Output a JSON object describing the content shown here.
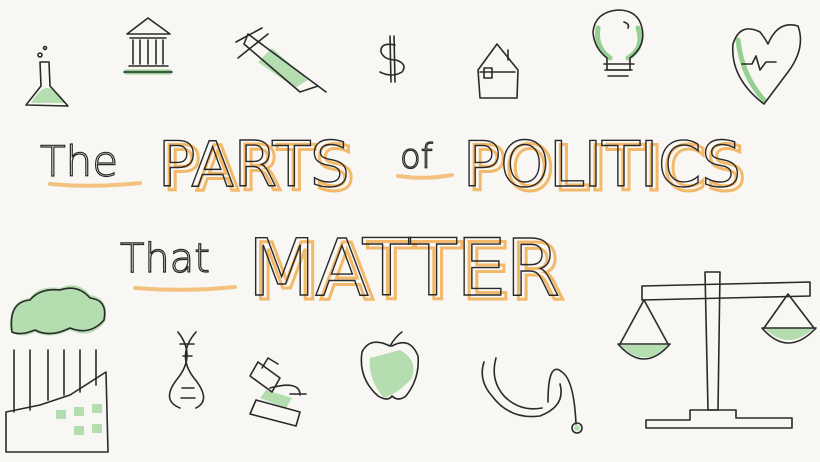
{
  "title": {
    "word1": "The",
    "word2": "PARTS",
    "word3": "of",
    "word4": "POLITICS",
    "word5": "That",
    "word6": "MATTER"
  },
  "icons": [
    "flask-icon",
    "courthouse-icon",
    "syringe-icon",
    "dollar-icon",
    "house-icon",
    "lightbulb-icon",
    "heart-icon",
    "factory-icon",
    "dna-icon",
    "microscope-icon",
    "apple-icon",
    "stethoscope-icon",
    "scales-icon"
  ],
  "colors": {
    "accent_green": "#a8d8a3",
    "accent_orange": "#f2b96b",
    "ink": "#2a2a2a",
    "background": "#f8f7f3"
  }
}
